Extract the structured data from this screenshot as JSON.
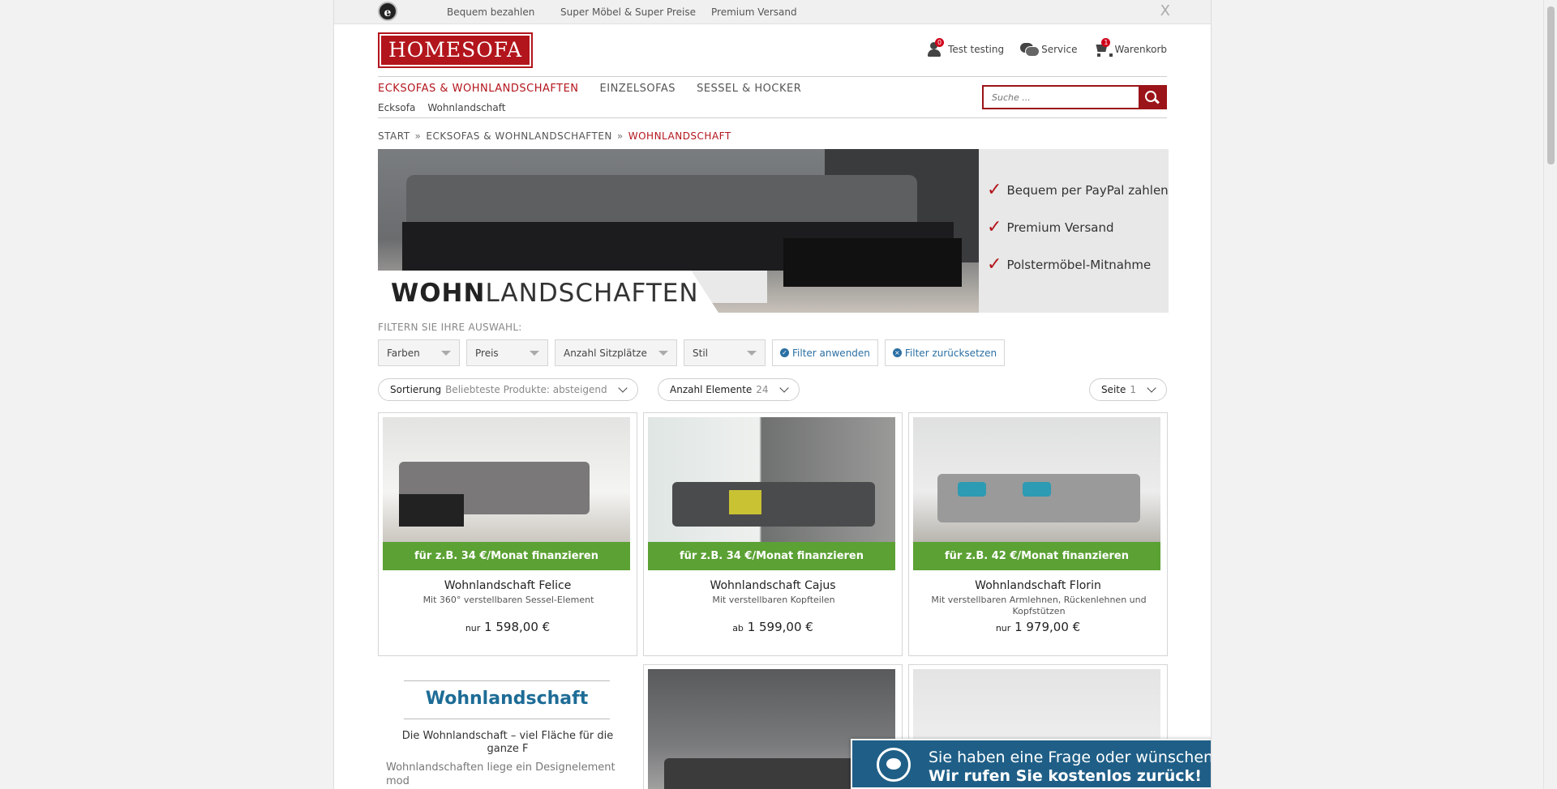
{
  "topbar": {
    "usps": [
      "Bequem bezahlen",
      "Super Möbel & Super Preise",
      "Premium Versand"
    ],
    "close_label": "X"
  },
  "header": {
    "logo_text": "HOMESOFA",
    "account": {
      "label": "Test testing",
      "badge": "0"
    },
    "service": {
      "label": "Service"
    },
    "cart": {
      "label": "Warenkorb",
      "badge": "1"
    }
  },
  "nav": {
    "main": [
      "ECKSOFAS & WOHNLANDSCHAFTEN",
      "EINZELSOFAS",
      "SESSEL & HOCKER"
    ],
    "sub": [
      "Ecksofa",
      "Wohnlandschaft"
    ],
    "search_placeholder": "Suche ..."
  },
  "breadcrumb": [
    "START",
    "ECKSOFAS & WOHNLANDSCHAFTEN",
    "WOHNLANDSCHAFT"
  ],
  "banner": {
    "title_bold": "WOHN",
    "title_rest": "LANDSCHAFTEN",
    "usps": [
      "Bequem per PayPal zahlen",
      "Premium Versand",
      "Polstermöbel-Mitnahme"
    ]
  },
  "filters": {
    "label": "FILTERN SIE IHRE AUSWAHL:",
    "dropdowns": [
      "Farben",
      "Preis",
      "Anzahl Sitzplätze",
      "Stil"
    ],
    "apply": "Filter anwenden",
    "reset": "Filter zurücksetzen"
  },
  "sorting": {
    "sort_label": "Sortierung",
    "sort_value": "Beliebteste Produkte: absteigend",
    "count_label": "Anzahl Elemente",
    "count_value": "24",
    "page_label": "Seite",
    "page_value": "1"
  },
  "products": [
    {
      "financing": "für z.B. 34 €/Monat finanzieren",
      "name": "Wohnlandschaft Felice",
      "desc": "Mit 360° verstellbaren Sessel-Element",
      "price_prefix": "nur",
      "price": "1 598,00 €"
    },
    {
      "financing": "für z.B. 34 €/Monat finanzieren",
      "name": "Wohnlandschaft Cajus",
      "desc": "Mit verstellbaren Kopfteilen",
      "price_prefix": "ab",
      "price": "1 599,00 €"
    },
    {
      "financing": "für z.B. 42 €/Monat finanzieren",
      "name": "Wohnlandschaft Florin",
      "desc": "Mit verstellbaren Armlehnen, Rückenlehnen und Kopfstützen",
      "price_prefix": "nur",
      "price": "1 979,00 €"
    }
  ],
  "info": {
    "title": "Wohnlandschaft",
    "subtitle": "Die Wohnlandschaft – viel Fläche für die ganze F",
    "text": "Wohnlandschaften liege ein Designelement mod"
  },
  "callback": {
    "line1": "Sie haben eine Frage oder wünschen eine Beratung?",
    "line2": "Wir rufen Sie kostenlos zurück!",
    "close": "x"
  },
  "colors": {
    "brand_red": "#b3151c",
    "financing_green": "#5ba134",
    "link_blue": "#2a6fa3",
    "popup_blue": "#1f5f87"
  }
}
